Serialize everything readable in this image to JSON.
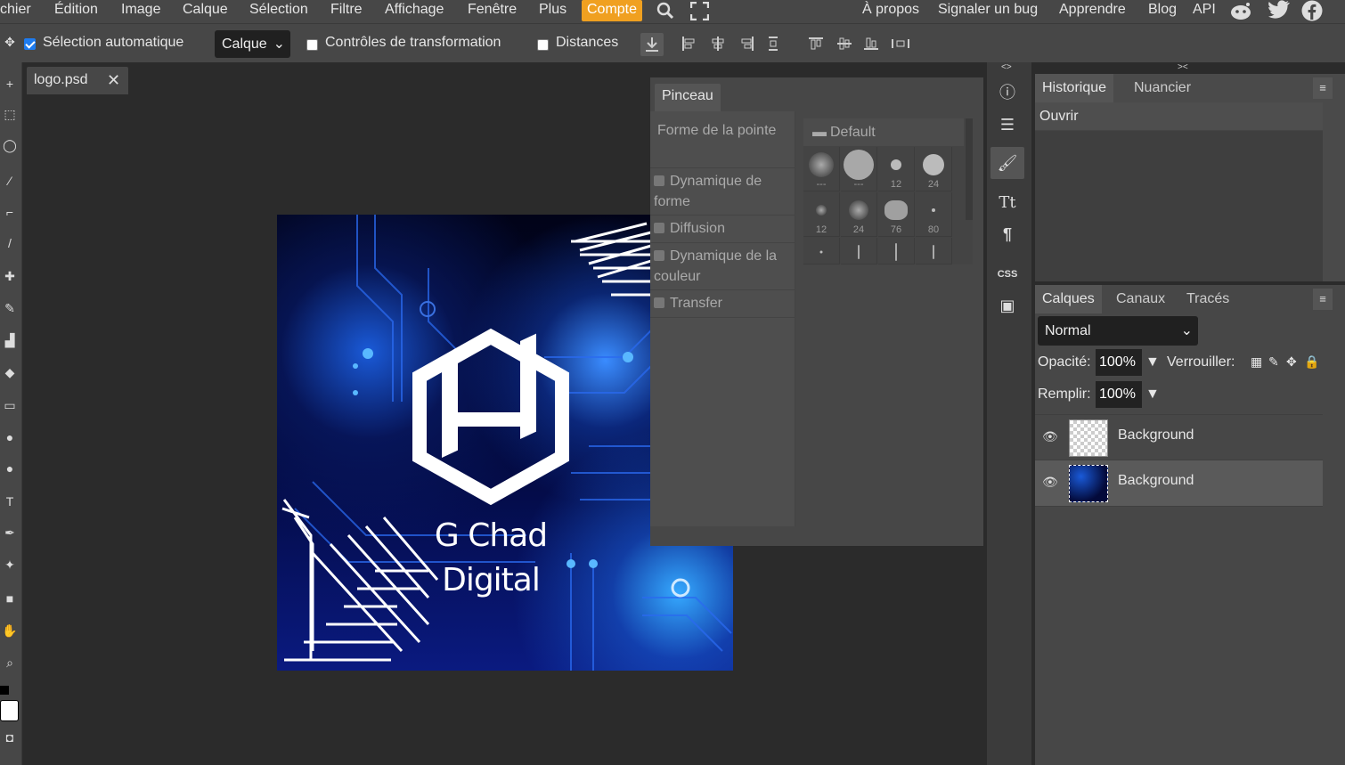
{
  "menu": {
    "items": [
      "chier",
      "Édition",
      "Image",
      "Calque",
      "Sélection",
      "Filtre",
      "Affichage",
      "Fenêtre",
      "Plus"
    ],
    "compte": "Compte",
    "right": [
      "À propos",
      "Signaler un bug",
      "Apprendre",
      "Blog",
      "API"
    ]
  },
  "options": {
    "auto_select_label": "Sélection automatique",
    "auto_select_checked": true,
    "calque_select": "Calque",
    "transform_label": "Contrôles de transformation",
    "distances_label": "Distances"
  },
  "document_tab": {
    "name": "logo.psd",
    "close": "✕"
  },
  "canvas": {
    "title_line1": "G Chad",
    "title_line2": "Digital"
  },
  "brush_panel": {
    "tab": "Pinceau",
    "options": [
      "Forme de la pointe",
      "Dynamique de forme",
      "Diffusion",
      "Dynamique de la couleur",
      "Transfer"
    ],
    "folder": "Default",
    "brushes": [
      {
        "size": "---"
      },
      {
        "size": "---"
      },
      {
        "size": "12"
      },
      {
        "size": "24"
      },
      {
        "size": "12"
      },
      {
        "size": "24"
      },
      {
        "size": "76"
      },
      {
        "size": "80"
      },
      {
        "size": ""
      },
      {
        "size": ""
      },
      {
        "size": ""
      },
      {
        "size": ""
      }
    ]
  },
  "history_panel": {
    "tabs": [
      "Historique",
      "Nuancier"
    ],
    "items": [
      "Ouvrir"
    ],
    "menu": "≡"
  },
  "layers_panel": {
    "tabs": [
      "Calques",
      "Canaux",
      "Tracés"
    ],
    "blend_mode": "Normal",
    "opacity_label": "Opacité:",
    "opacity_value": "100%",
    "lock_label": "Verrouiller:",
    "fill_label": "Remplir:",
    "fill_value": "100%",
    "layers": [
      {
        "name": "Background",
        "selected": false
      },
      {
        "name": "Background",
        "selected": true
      }
    ]
  },
  "icons": {
    "search": "search-icon",
    "fullscreen": "fullscreen-icon",
    "reddit": "reddit-icon",
    "twitter": "twitter-icon",
    "facebook": "facebook-icon"
  },
  "colors": {
    "accent": "#f0a020",
    "checkbox": "#1e7cf0",
    "panel_bg": "#474747"
  }
}
